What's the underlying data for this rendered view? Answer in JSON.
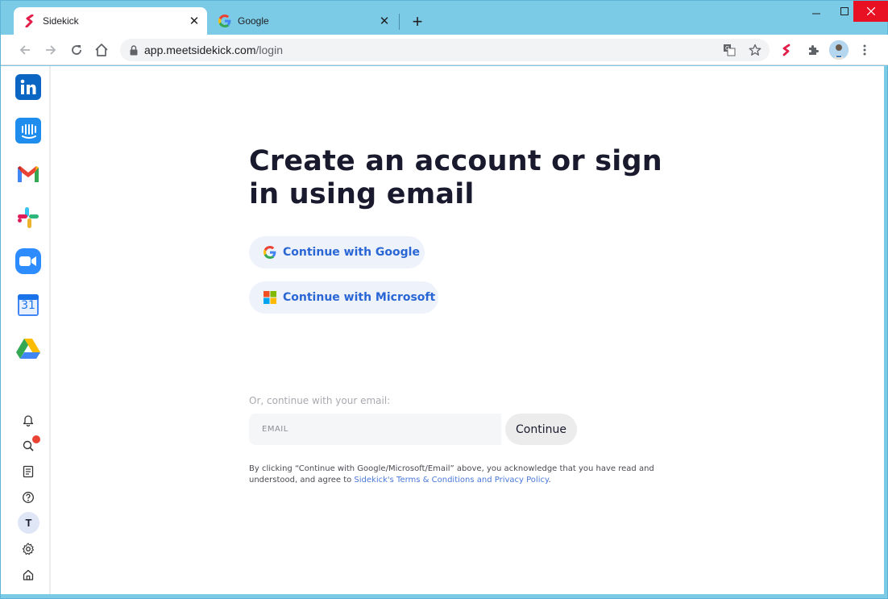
{
  "browser": {
    "tabs": [
      {
        "title": "Sidekick"
      },
      {
        "title": "Google"
      }
    ],
    "new_tab": "+",
    "url_host": "app.meetsidekick.com",
    "url_path": "/login"
  },
  "sidebar": {
    "apps": [
      "linkedin-icon",
      "intercom-icon",
      "gmail-icon",
      "slack-icon",
      "zoom-icon",
      "calendar-icon",
      "drive-icon"
    ],
    "calendar_day": "31",
    "avatar_initial": "T"
  },
  "page": {
    "heading": "Create an account or sign in using email",
    "google_label": "Continue with Google",
    "microsoft_label": "Continue with Microsoft",
    "or_label": "Or, continue with your email:",
    "email_placeholder": "EMAIL",
    "continue_label": "Continue",
    "legal_prefix": "By clicking “Continue with Google/Microsoft/Email” above, you acknowledge that you have read and understood, and agree to ",
    "legal_link": "Sidekick's Terms & Conditions and Privacy Policy",
    "legal_suffix": "."
  },
  "colors": {
    "accent": "#2a66d4",
    "button_bg": "#edf2fb",
    "frame": "#7ccbe6"
  }
}
